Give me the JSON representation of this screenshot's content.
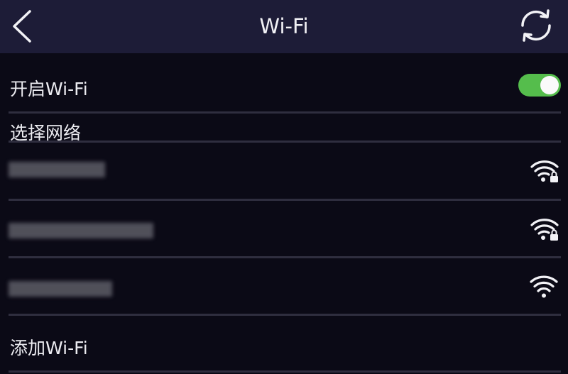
{
  "header": {
    "title": "Wi-Fi",
    "back_icon": "chevron-left-icon",
    "refresh_icon": "refresh-icon"
  },
  "wifi_toggle": {
    "label": "开启Wi-Fi",
    "enabled": true,
    "on_color": "#55bd4c"
  },
  "network_section": {
    "label": "选择网络"
  },
  "networks": [
    {
      "name": "",
      "secured": true,
      "icon": "wifi-locked-icon"
    },
    {
      "name": "",
      "secured": true,
      "icon": "wifi-locked-icon"
    },
    {
      "name": "",
      "secured": false,
      "icon": "wifi-icon"
    }
  ],
  "add_wifi": {
    "label": "添加Wi-Fi"
  },
  "colors": {
    "header_bg": "#1d1c37",
    "page_bg": "#0b0a16",
    "divider": "#2f2e3f"
  }
}
